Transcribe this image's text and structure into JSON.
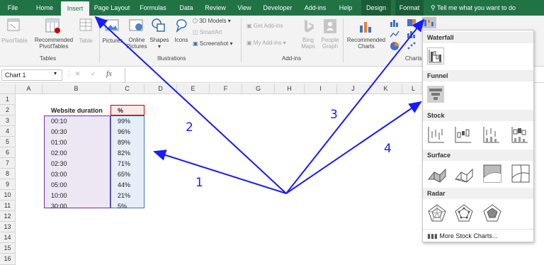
{
  "ribbon_tabs": [
    "File",
    "Home",
    "Insert",
    "Page Layout",
    "Formulas",
    "Data",
    "Review",
    "View",
    "Developer",
    "Add-ins",
    "Help",
    "Design",
    "Format"
  ],
  "tell_me": "Tell me what you want to do",
  "tables_group": {
    "pivottable": "PivotTable",
    "recommended_pivot_line1": "Recommended",
    "recommended_pivot_line2": "PivotTables",
    "table": "Table",
    "label": "Tables"
  },
  "illustrations_group": {
    "pictures": "Pictures",
    "online_pictures_line1": "Online",
    "online_pictures_line2": "Pictures",
    "shapes": "Shapes",
    "icons": "Icons",
    "models": "3D Models",
    "smartart": "SmartArt",
    "screenshot": "Screenshot",
    "label": "Illustrations"
  },
  "addins_group": {
    "get": "Get Add-ins",
    "my": "My Add-ins",
    "bing_line1": "Bing",
    "bing_line2": "Maps",
    "people_line1": "People",
    "people_line2": "Graph",
    "label": "Add-ins"
  },
  "charts_group": {
    "recommended_line1": "Recommended",
    "recommended_line2": "Charts",
    "label": "Charts"
  },
  "name_box": "Chart 1",
  "formula_icons": {
    "cancel": "✕",
    "enter": "✓",
    "fx": "fx"
  },
  "columns": [
    "A",
    "B",
    "C",
    "D",
    "E",
    "F",
    "G",
    "H",
    "I",
    "J",
    "K",
    "L"
  ],
  "rows": [
    "1",
    "2",
    "3",
    "4",
    "5",
    "6",
    "7",
    "8",
    "9",
    "10",
    "11",
    "12",
    "13",
    "14",
    "15",
    "16"
  ],
  "table": {
    "header": [
      "Website duration",
      "%"
    ],
    "rows": [
      [
        "00:10",
        "99%"
      ],
      [
        "00:30",
        "96%"
      ],
      [
        "01:00",
        "89%"
      ],
      [
        "02:00",
        "82%"
      ],
      [
        "02:30",
        "71%"
      ],
      [
        "03:00",
        "65%"
      ],
      [
        "05:00",
        "44%"
      ],
      [
        "10:00",
        "21%"
      ],
      [
        "30:00",
        "5%"
      ]
    ]
  },
  "dropdown": {
    "waterfall": "Waterfall",
    "funnel": "Funnel",
    "stock": "Stock",
    "surface": "Surface",
    "radar": "Radar",
    "more": "More Stock Charts..."
  },
  "annotations": [
    "1",
    "2",
    "3",
    "4"
  ],
  "colors": {
    "excel_green": "#217346",
    "annotation_blue": "#1a1aff",
    "selection_purple": "#7030a0",
    "selection_blue": "#4472c4"
  }
}
